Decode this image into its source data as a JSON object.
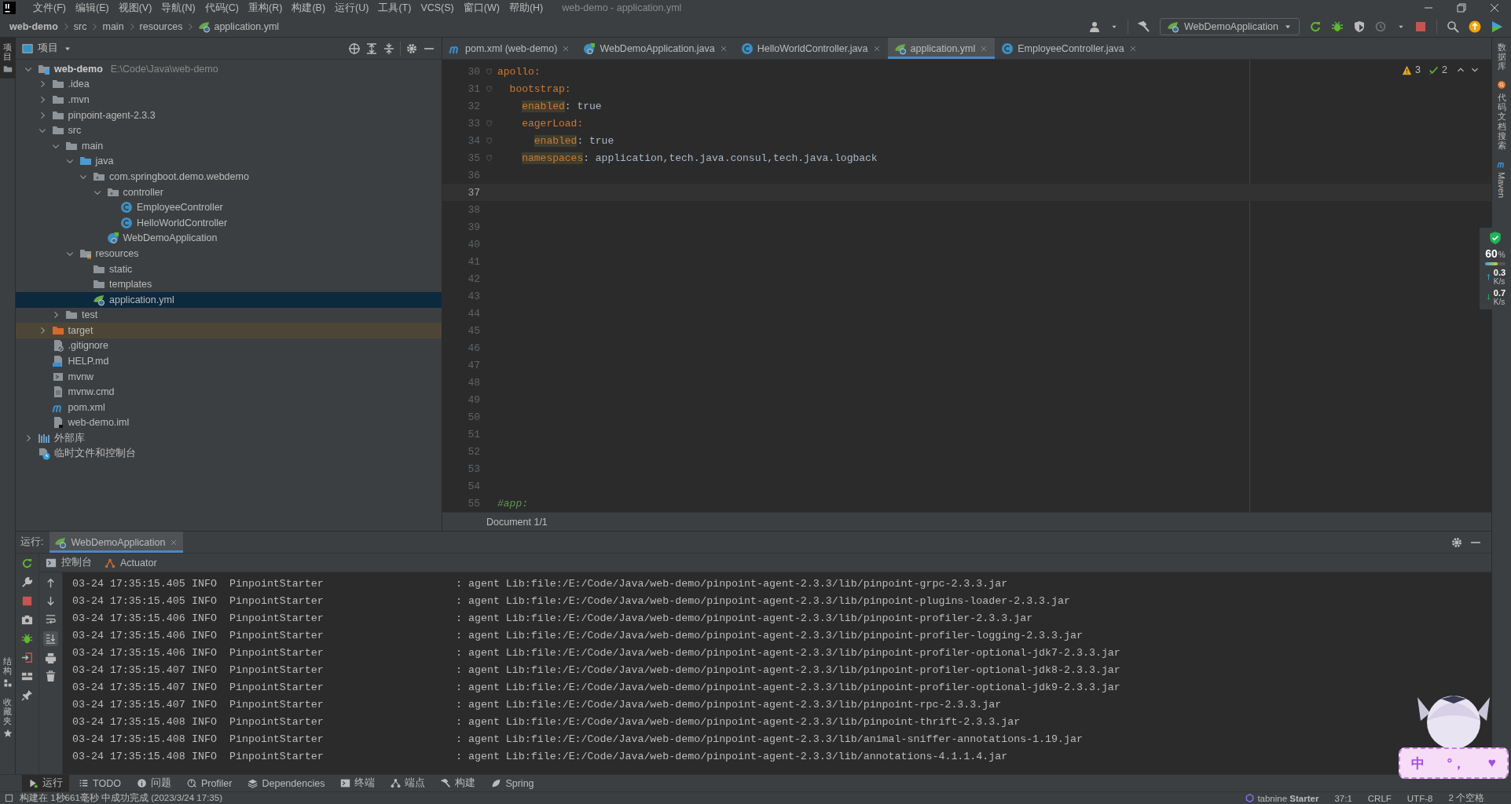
{
  "menu": {
    "items": [
      "文件(F)",
      "编辑(E)",
      "视图(V)",
      "导航(N)",
      "代码(C)",
      "重构(R)",
      "构建(B)",
      "运行(U)",
      "工具(T)",
      "VCS(S)",
      "窗口(W)",
      "帮助(H)"
    ],
    "title": "web-demo - application.yml"
  },
  "breadcrumb": [
    {
      "label": "web-demo",
      "kind": "project"
    },
    {
      "label": "src",
      "kind": "plain"
    },
    {
      "label": "main",
      "kind": "plain"
    },
    {
      "label": "resources",
      "kind": "plain"
    },
    {
      "label": "application.yml",
      "kind": "yml"
    }
  ],
  "toolbar": {
    "run_config": "WebDemoApplication"
  },
  "left_strip": {
    "top": [
      {
        "label": "项目",
        "kind": "folder",
        "selected": true
      }
    ],
    "bottom": [
      {
        "label": "结构",
        "kind": "structure",
        "selected": false
      },
      {
        "label": "收藏夹",
        "kind": "star",
        "selected": false
      }
    ]
  },
  "right_strip": [
    {
      "label": "数据库",
      "kind": "database"
    },
    {
      "label": "代码文档搜索",
      "kind": "doc-search"
    },
    {
      "label": "Maven",
      "kind": "maven"
    }
  ],
  "monitor": {
    "memory": "60",
    "memory_unit": "%",
    "level": 0.6,
    "upload": "0.3",
    "upload_unit": "K/s",
    "download": "0.7",
    "download_unit": "K/s"
  },
  "project": {
    "title": "项目",
    "tree": [
      {
        "name": "web-demo",
        "path": "E:\\Code\\Java\\web-demo",
        "kind": "module",
        "expanded": true,
        "selected": false,
        "children": [
          {
            "name": ".idea",
            "kind": "folder",
            "expanded": false,
            "selected": false
          },
          {
            "name": ".mvn",
            "kind": "folder",
            "expanded": false,
            "selected": false
          },
          {
            "name": "pinpoint-agent-2.3.3",
            "kind": "folder",
            "expanded": false,
            "selected": false
          },
          {
            "name": "src",
            "kind": "folder",
            "expanded": true,
            "selected": false,
            "children": [
              {
                "name": "main",
                "kind": "folder",
                "expanded": true,
                "selected": false,
                "children": [
                  {
                    "name": "java",
                    "kind": "source-folder",
                    "expanded": true,
                    "selected": false,
                    "children": [
                      {
                        "name": "com.springboot.demo.webdemo",
                        "kind": "package",
                        "expanded": true,
                        "selected": false,
                        "children": [
                          {
                            "name": "controller",
                            "kind": "package",
                            "expanded": true,
                            "selected": false,
                            "children": [
                              {
                                "name": "EmployeeController",
                                "kind": "class",
                                "selected": false
                              },
                              {
                                "name": "HelloWorldController",
                                "kind": "class",
                                "selected": false
                              }
                            ]
                          },
                          {
                            "name": "WebDemoApplication",
                            "kind": "spring-class",
                            "selected": false
                          }
                        ]
                      }
                    ]
                  },
                  {
                    "name": "resources",
                    "kind": "resources-folder",
                    "expanded": true,
                    "selected": false,
                    "children": [
                      {
                        "name": "static",
                        "kind": "folder",
                        "selected": false
                      },
                      {
                        "name": "templates",
                        "kind": "folder",
                        "selected": false
                      },
                      {
                        "name": "application.yml",
                        "kind": "yml",
                        "selected": true
                      }
                    ]
                  }
                ]
              },
              {
                "name": "test",
                "kind": "folder",
                "expanded": false,
                "selected": false
              }
            ]
          },
          {
            "name": "target",
            "kind": "excluded-folder",
            "expanded": false,
            "selected": false
          },
          {
            "name": ".gitignore",
            "kind": "gitignore",
            "selected": false
          },
          {
            "name": "HELP.md",
            "kind": "markdown",
            "selected": false
          },
          {
            "name": "mvnw",
            "kind": "script",
            "selected": false
          },
          {
            "name": "mvnw.cmd",
            "kind": "text-file",
            "selected": false
          },
          {
            "name": "pom.xml",
            "kind": "maven",
            "selected": false
          },
          {
            "name": "web-demo.iml",
            "kind": "module-file",
            "selected": false
          }
        ]
      },
      {
        "name": "外部库",
        "kind": "library",
        "expanded": false,
        "selected": false
      },
      {
        "name": "临时文件和控制台",
        "kind": "scratch",
        "selected": false
      }
    ]
  },
  "editor": {
    "tabs": [
      {
        "label": "pom.xml (web-demo)",
        "kind": "maven",
        "selected": false
      },
      {
        "label": "WebDemoApplication.java",
        "kind": "spring-class",
        "selected": false
      },
      {
        "label": "HelloWorldController.java",
        "kind": "class",
        "selected": false
      },
      {
        "label": "application.yml",
        "kind": "yml",
        "selected": true
      },
      {
        "label": "EmployeeController.java",
        "kind": "class",
        "selected": false
      }
    ],
    "warnings": "3",
    "passed": "2",
    "lines": [
      {
        "number": "30",
        "key": "apollo:",
        "fold": true,
        "current": false,
        "children": [
          {
            "number": "31",
            "key": "bootstrap:",
            "fold": true,
            "current": false,
            "children": [
              {
                "number": "32",
                "key": "enabled",
                "value": ": true",
                "highlight": true,
                "current": false
              },
              {
                "number": "33",
                "key": "eagerLoad:",
                "fold": true,
                "current": false,
                "children": [
                  {
                    "number": "34",
                    "key": "enabled",
                    "value": ": true",
                    "highlight": true,
                    "fold": true,
                    "current": false
                  }
                ]
              },
              {
                "number": "35",
                "key": "namespaces",
                "value": ": application,tech.java.consul,tech.java.logback",
                "highlight": true,
                "fold": true,
                "current": false
              }
            ]
          }
        ]
      },
      {
        "number": "36",
        "current": false
      },
      {
        "number": "37",
        "current": true
      },
      {
        "number": "38",
        "current": false
      },
      {
        "number": "39",
        "current": false
      },
      {
        "number": "40",
        "current": false
      },
      {
        "number": "41",
        "current": false
      },
      {
        "number": "42",
        "current": false
      },
      {
        "number": "43",
        "current": false
      },
      {
        "number": "44",
        "current": false
      },
      {
        "number": "45",
        "current": false
      },
      {
        "number": "46",
        "current": false
      },
      {
        "number": "47",
        "current": false
      },
      {
        "number": "48",
        "current": false
      },
      {
        "number": "49",
        "current": false
      },
      {
        "number": "50",
        "current": false
      },
      {
        "number": "51",
        "current": false
      },
      {
        "number": "52",
        "current": false
      },
      {
        "number": "53",
        "current": false
      },
      {
        "number": "54",
        "current": false
      },
      {
        "number": "55",
        "kind": "comment",
        "key": "#app:",
        "current": false
      }
    ],
    "footer": "Document 1/1"
  },
  "run": {
    "label": "运行:",
    "tabs": [
      {
        "label": "WebDemoApplication",
        "selected": true
      }
    ],
    "subtabs": [
      {
        "label": "控制台",
        "kind": "console"
      },
      {
        "label": "Actuator",
        "kind": "actuator"
      }
    ],
    "autoscroll": true,
    "log": [
      {
        "time": "03-24 17:35:15.405",
        "level": "INFO",
        "logger": "PinpointStarter",
        "message": ": agent Lib:file:/E:/Code/Java/web-demo/pinpoint-agent-2.3.3/lib/pinpoint-grpc-2.3.3.jar"
      },
      {
        "time": "03-24 17:35:15.405",
        "level": "INFO",
        "logger": "PinpointStarter",
        "message": ": agent Lib:file:/E:/Code/Java/web-demo/pinpoint-agent-2.3.3/lib/pinpoint-plugins-loader-2.3.3.jar"
      },
      {
        "time": "03-24 17:35:15.406",
        "level": "INFO",
        "logger": "PinpointStarter",
        "message": ": agent Lib:file:/E:/Code/Java/web-demo/pinpoint-agent-2.3.3/lib/pinpoint-profiler-2.3.3.jar"
      },
      {
        "time": "03-24 17:35:15.406",
        "level": "INFO",
        "logger": "PinpointStarter",
        "message": ": agent Lib:file:/E:/Code/Java/web-demo/pinpoint-agent-2.3.3/lib/pinpoint-profiler-logging-2.3.3.jar"
      },
      {
        "time": "03-24 17:35:15.406",
        "level": "INFO",
        "logger": "PinpointStarter",
        "message": ": agent Lib:file:/E:/Code/Java/web-demo/pinpoint-agent-2.3.3/lib/pinpoint-profiler-optional-jdk7-2.3.3.jar"
      },
      {
        "time": "03-24 17:35:15.407",
        "level": "INFO",
        "logger": "PinpointStarter",
        "message": ": agent Lib:file:/E:/Code/Java/web-demo/pinpoint-agent-2.3.3/lib/pinpoint-profiler-optional-jdk8-2.3.3.jar"
      },
      {
        "time": "03-24 17:35:15.407",
        "level": "INFO",
        "logger": "PinpointStarter",
        "message": ": agent Lib:file:/E:/Code/Java/web-demo/pinpoint-agent-2.3.3/lib/pinpoint-profiler-optional-jdk9-2.3.3.jar"
      },
      {
        "time": "03-24 17:35:15.407",
        "level": "INFO",
        "logger": "PinpointStarter",
        "message": ": agent Lib:file:/E:/Code/Java/web-demo/pinpoint-agent-2.3.3/lib/pinpoint-rpc-2.3.3.jar"
      },
      {
        "time": "03-24 17:35:15.408",
        "level": "INFO",
        "logger": "PinpointStarter",
        "message": ": agent Lib:file:/E:/Code/Java/web-demo/pinpoint-agent-2.3.3/lib/pinpoint-thrift-2.3.3.jar"
      },
      {
        "time": "03-24 17:35:15.408",
        "level": "INFO",
        "logger": "PinpointStarter",
        "message": ": agent Lib:file:/E:/Code/Java/web-demo/pinpoint-agent-2.3.3/lib/animal-sniffer-annotations-1.19.jar"
      },
      {
        "time": "03-24 17:35:15.408",
        "level": "INFO",
        "logger": "PinpointStarter",
        "message": ": agent Lib:file:/E:/Code/Java/web-demo/pinpoint-agent-2.3.3/lib/annotations-4.1.1.4.jar"
      }
    ]
  },
  "bottom_tools": [
    {
      "label": "运行",
      "kind": "play",
      "selected": true
    },
    {
      "label": "TODO",
      "kind": "list",
      "selected": false
    },
    {
      "label": "问题",
      "kind": "info",
      "selected": false
    },
    {
      "label": "Profiler",
      "kind": "profiler",
      "selected": false
    },
    {
      "label": "Dependencies",
      "kind": "layers",
      "selected": false
    },
    {
      "label": "终端",
      "kind": "terminal",
      "selected": false
    },
    {
      "label": "端点",
      "kind": "endpoints",
      "selected": false
    },
    {
      "label": "构建",
      "kind": "hammer",
      "selected": false
    },
    {
      "label": "Spring",
      "kind": "leaf",
      "selected": false
    }
  ],
  "status": {
    "message": "构建在 1秒661毫秒 中成功完成 (2023/3/24 17:35)",
    "items": [
      {
        "label": "tabnine **Starter**",
        "kind": "tabnine"
      },
      {
        "label": "37:1",
        "kind": "plain"
      },
      {
        "label": "CRLF",
        "kind": "plain"
      },
      {
        "label": "UTF-8",
        "kind": "plain"
      },
      {
        "label": "2 个空格",
        "kind": "plain"
      }
    ]
  },
  "ime": {
    "keys": [
      "中",
      "°，",
      "♥"
    ]
  }
}
